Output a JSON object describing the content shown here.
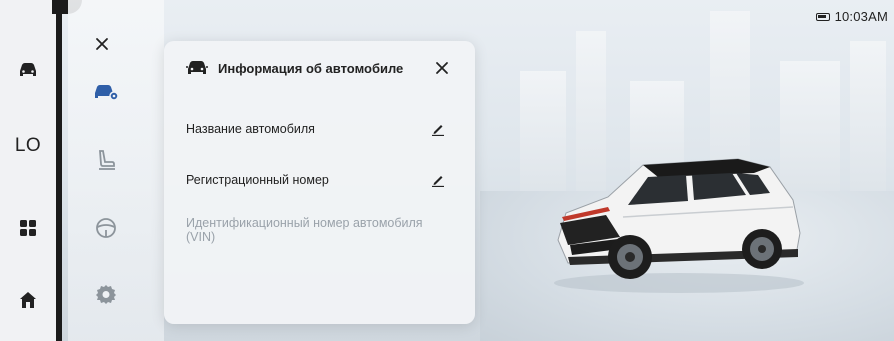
{
  "status_bar": {
    "time": "10:03AM"
  },
  "left_rail": {
    "items": [
      {
        "icon": "car-icon"
      },
      {
        "label": "LO"
      },
      {
        "icon": "apps-grid-icon"
      },
      {
        "icon": "home-icon"
      }
    ]
  },
  "side_menu": {
    "close_icon": "close-icon",
    "items": [
      {
        "icon": "car-settings-icon",
        "active": true
      },
      {
        "icon": "seat-icon"
      },
      {
        "icon": "steering-wheel-icon"
      },
      {
        "icon": "gear-icon"
      }
    ]
  },
  "dialog": {
    "title": "Информация об автомобиле",
    "rows": [
      {
        "label": "Название автомобиля",
        "editable": true
      },
      {
        "label": "Регистрационный номер",
        "editable": true
      },
      {
        "label": "Идентификационный номер автомобиля (VIN)",
        "editable": false
      }
    ]
  },
  "colors": {
    "accent": "#2f5fa8",
    "rail_border": "#1b1b1b",
    "text": "#222222",
    "disabled_text": "#9aa2aa"
  }
}
